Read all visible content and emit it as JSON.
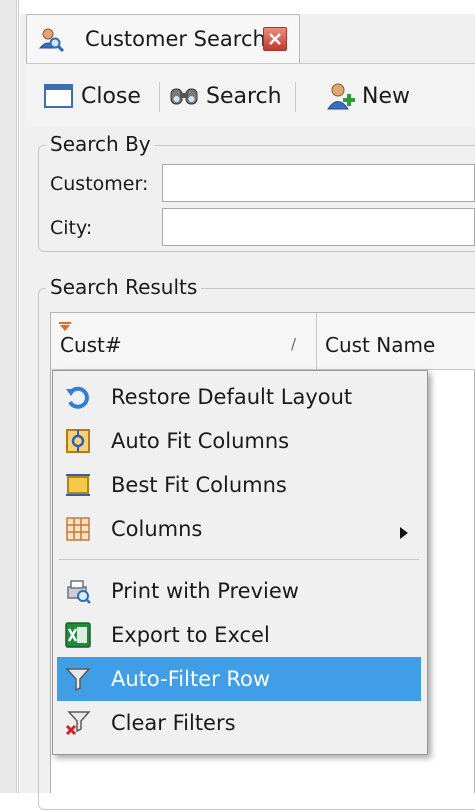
{
  "tab": {
    "title": "Customer Search"
  },
  "toolbar": {
    "close_label": "Close",
    "search_label": "Search",
    "new_label": "New"
  },
  "search_by": {
    "title": "Search By",
    "customer_label": "Customer:",
    "customer_value": "",
    "city_label": "City:",
    "city_value": ""
  },
  "results": {
    "title": "Search Results",
    "columns": [
      "Cust#",
      "Cust Name"
    ]
  },
  "context_menu": {
    "items": [
      {
        "label": "Restore Default Layout",
        "icon": "restore-layout-icon"
      },
      {
        "label": "Auto Fit Columns",
        "icon": "auto-fit-icon"
      },
      {
        "label": "Best Fit Columns",
        "icon": "best-fit-icon"
      },
      {
        "label": "Columns",
        "icon": "columns-icon",
        "submenu": true
      },
      {
        "label": "Print with Preview",
        "icon": "print-preview-icon"
      },
      {
        "label": "Export to Excel",
        "icon": "excel-icon"
      },
      {
        "label": "Auto-Filter Row",
        "icon": "filter-icon",
        "selected": true
      },
      {
        "label": "Clear Filters",
        "icon": "clear-filter-icon"
      }
    ]
  },
  "colors": {
    "selection": "#3f9ee6",
    "panel": "#f0f0f0",
    "close_tab": "#c0392b"
  }
}
